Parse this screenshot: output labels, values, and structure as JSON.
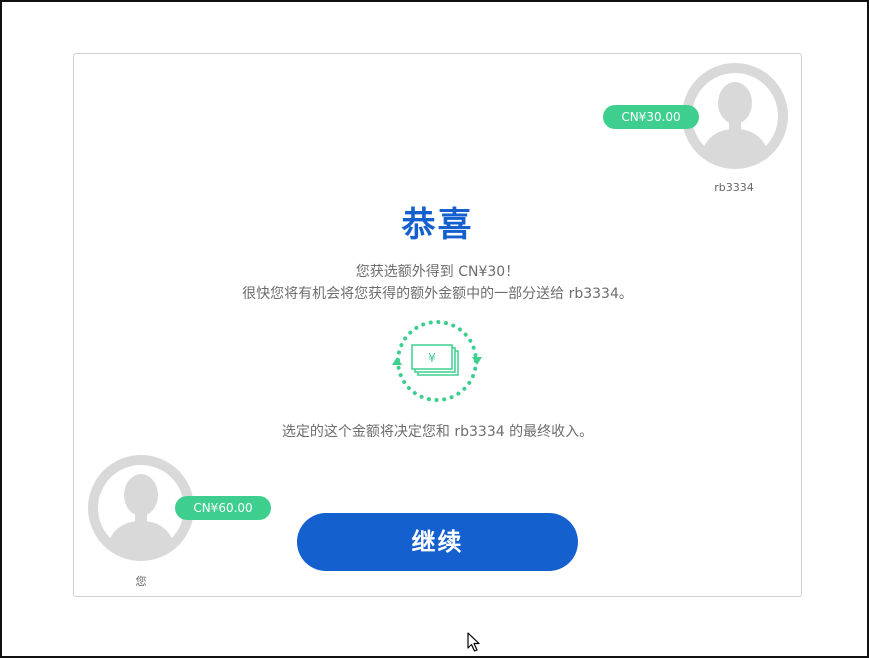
{
  "partner": {
    "name": "rb3334",
    "amount": "CN¥30.00"
  },
  "self": {
    "name": "您",
    "amount": "CN¥60.00"
  },
  "main": {
    "title": "恭喜",
    "line1": "您获选额外得到 CN¥30！",
    "line2": "很快您将有机会将您获得的额外金额中的一部分送给 rb3334。",
    "line3": "选定的这个金额将决定您和 rb3334 的最终收入。",
    "icon_symbol": "¥",
    "icon_name": "money-exchange-icon"
  },
  "actions": {
    "continue_label": "继续"
  },
  "colors": {
    "accent": "#1560cf",
    "money_green": "#3ecf8e",
    "avatar_gray": "#d9d9d9"
  }
}
